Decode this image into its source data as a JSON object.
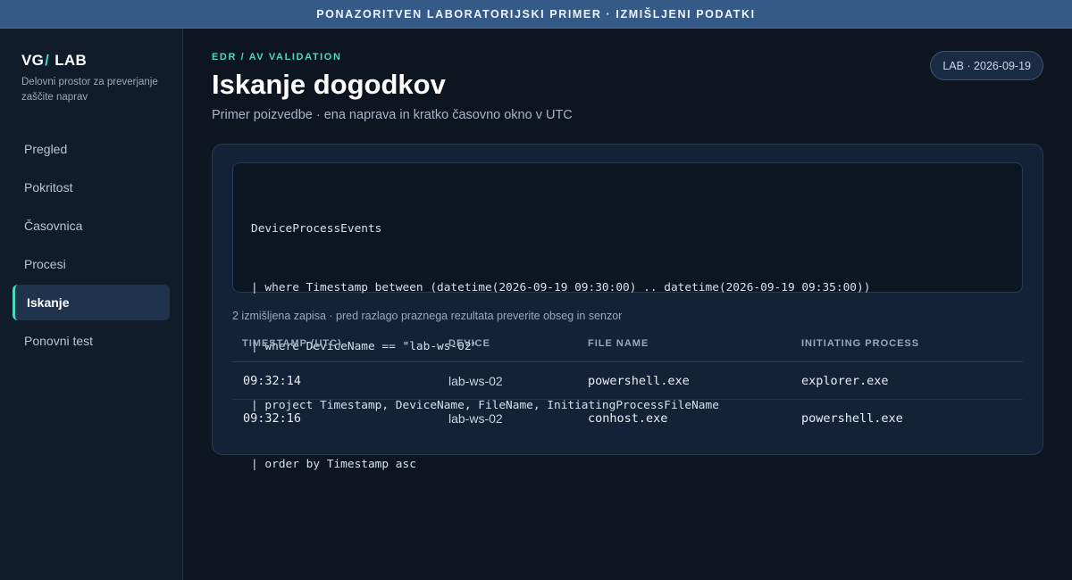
{
  "banner": {
    "text": "PONAZORITVEN LABORATORIJSKI PRIMER · IZMIŠLJENI PODATKI"
  },
  "brand": {
    "left": "VG",
    "slash": "/",
    "right": " LAB",
    "subtitle": "Delovni prostor za preverjanje zaščite naprav"
  },
  "sidebar": {
    "items": [
      {
        "label": "Pregled",
        "active": false
      },
      {
        "label": "Pokritost",
        "active": false
      },
      {
        "label": "Časovnica",
        "active": false
      },
      {
        "label": "Procesi",
        "active": false
      },
      {
        "label": "Iskanje",
        "active": true
      },
      {
        "label": "Ponovni test",
        "active": false
      }
    ]
  },
  "header": {
    "eyebrow": "EDR / AV VALIDATION",
    "title": "Iskanje dogodkov",
    "subtitle": "Primer poizvedbe · ena naprava in kratko časovno okno v UTC",
    "badge": "LAB · 2026-09-19"
  },
  "query": {
    "lines": [
      "DeviceProcessEvents",
      "| where Timestamp between (datetime(2026-09-19 09:30:00) .. datetime(2026-09-19 09:35:00))",
      "| where DeviceName == \"lab-ws-02\"",
      "| project Timestamp, DeviceName, FileName, InitiatingProcessFileName",
      "| order by Timestamp asc"
    ]
  },
  "results": {
    "note": "2 izmišljena zapisa · pred razlago praznega rezultata preverite obseg in senzor",
    "columns": [
      "TIMESTAMP (UTC)",
      "DEVICE",
      "FILE NAME",
      "INITIATING PROCESS"
    ],
    "rows": [
      [
        "09:32:14",
        "lab-ws-02",
        "powershell.exe",
        "explorer.exe"
      ],
      [
        "09:32:16",
        "lab-ws-02",
        "conhost.exe",
        "powershell.exe"
      ]
    ]
  },
  "colors": {
    "accent": "#4dd9c0",
    "banner": "#355a88",
    "background": "#0d1521"
  }
}
